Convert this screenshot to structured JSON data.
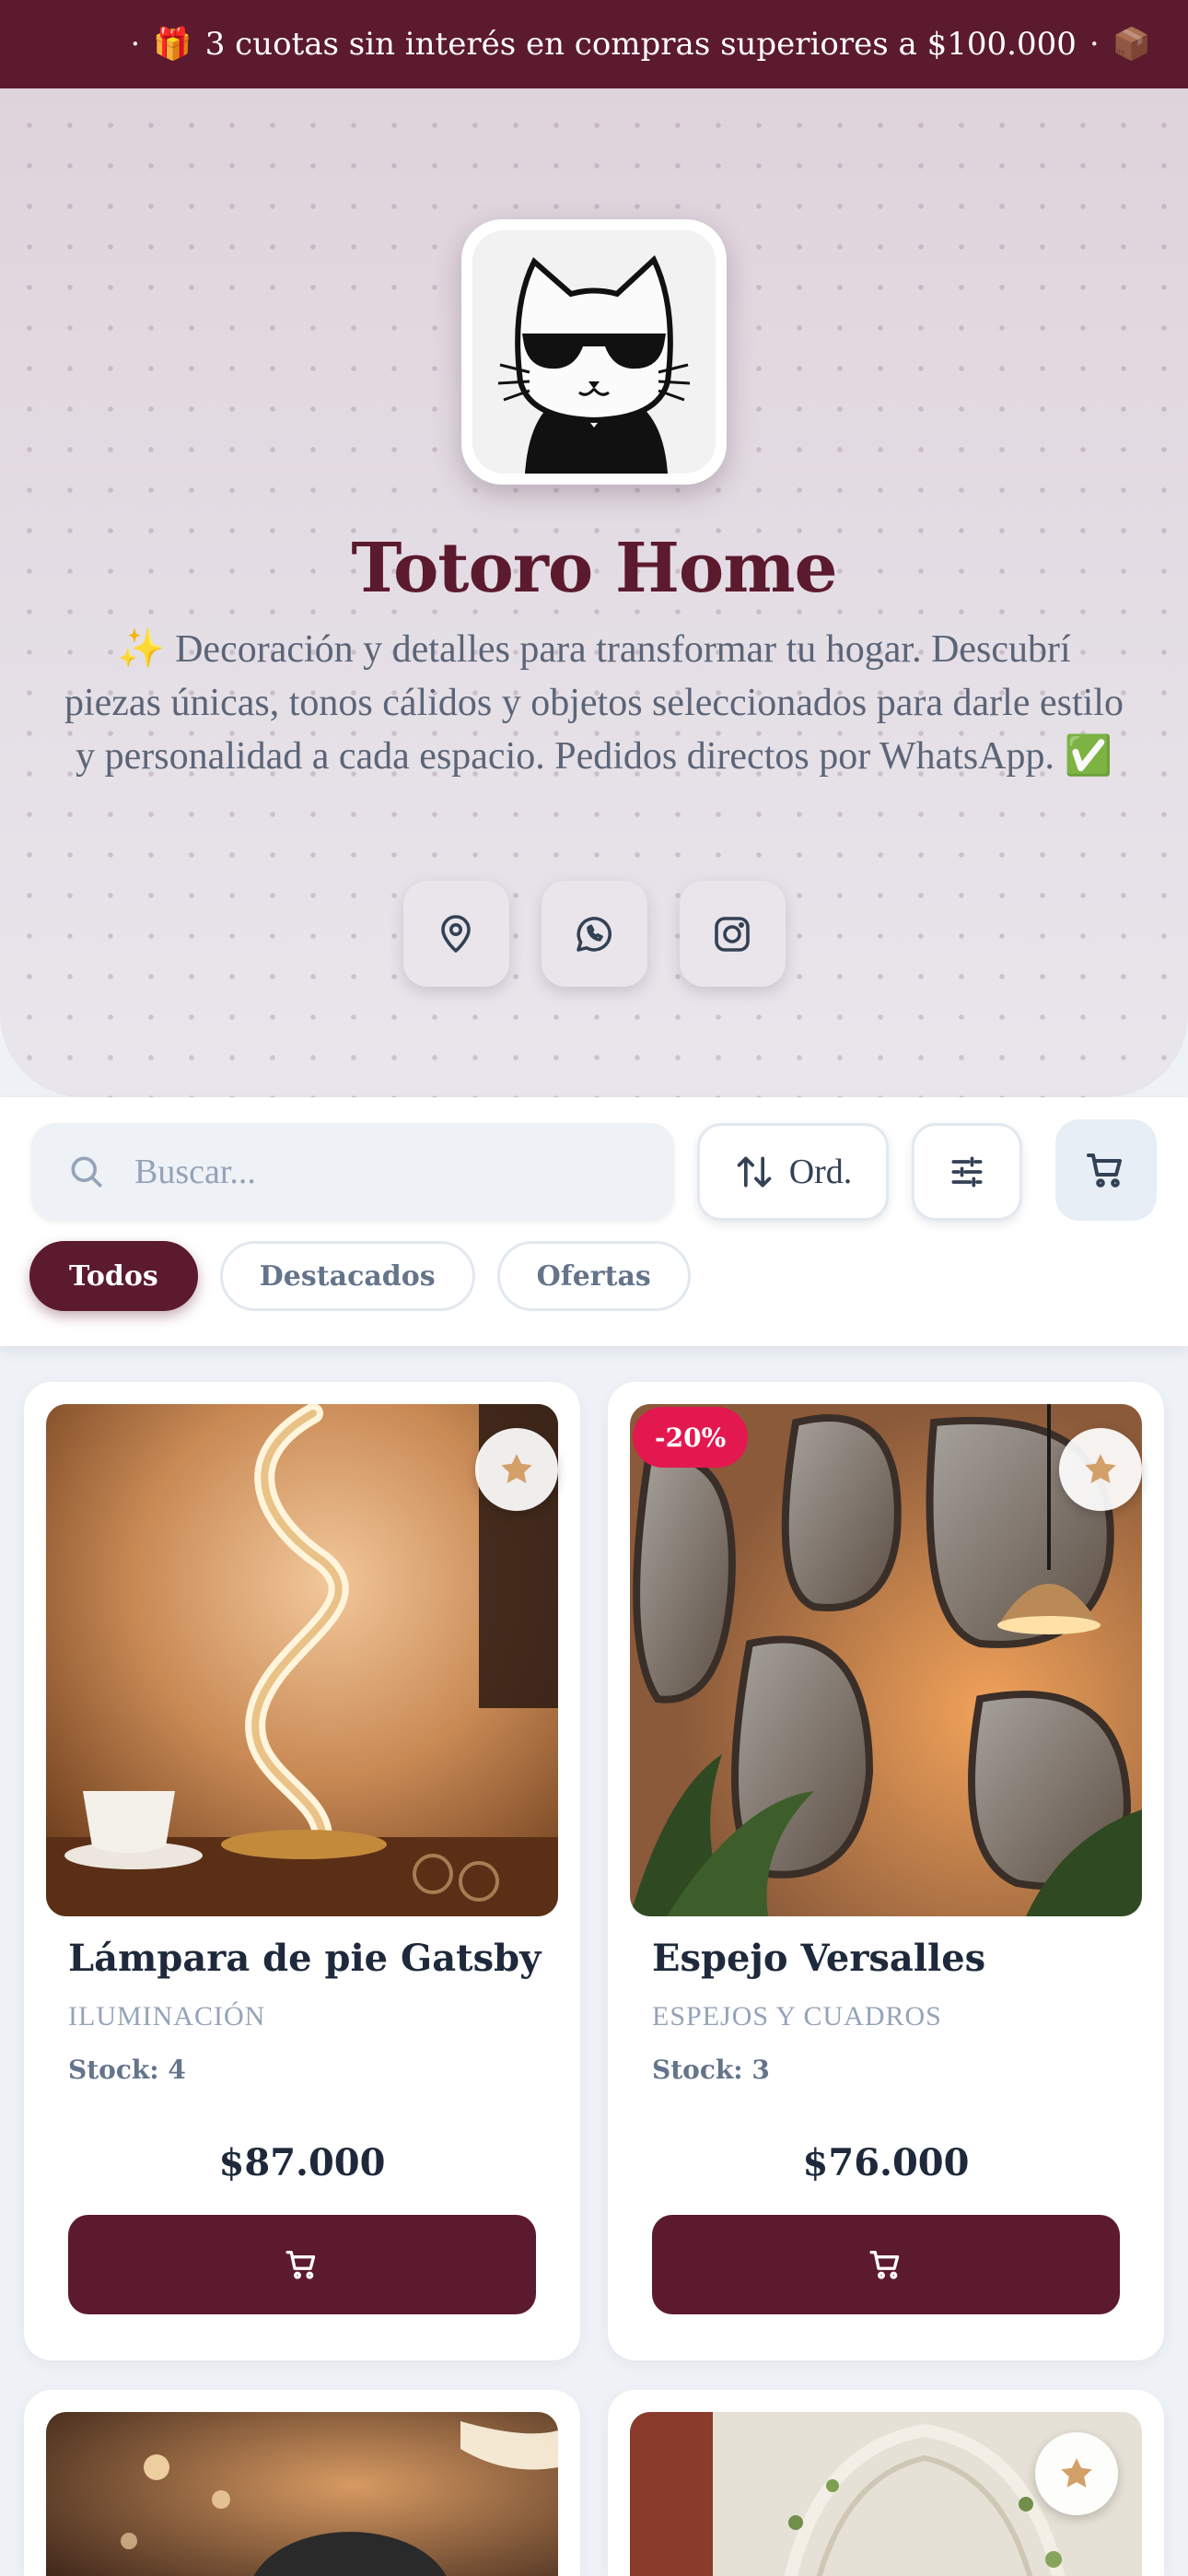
{
  "announcement": {
    "text": "3 cuotas sin interés en compras superiores a $100.000",
    "separator": "·",
    "leading_icon": "gift-icon",
    "trailing_icon": "package-icon"
  },
  "store": {
    "name": "Totoro Home",
    "description": "✨ Decoración y detalles para transformar tu hogar. Descubrí piezas únicas, tonos cálidos y objetos seleccionados para darle estilo y personalidad a cada espacio. Pedidos directos por WhatsApp. ✅",
    "logo": "cat-with-sunglasses-logo",
    "social": [
      {
        "name": "location",
        "icon": "map-pin-icon"
      },
      {
        "name": "whatsapp",
        "icon": "whatsapp-icon"
      },
      {
        "name": "instagram",
        "icon": "instagram-icon"
      }
    ]
  },
  "toolbar": {
    "search_placeholder": "Buscar...",
    "sort_label": "Ord.",
    "filter_icon": "sliders-icon",
    "cart_icon": "cart-icon"
  },
  "chips": [
    {
      "label": "Todos",
      "active": true
    },
    {
      "label": "Destacados",
      "active": false
    },
    {
      "label": "Ofertas",
      "active": false
    }
  ],
  "products": [
    {
      "name": "Lámpara de pie Gatsby",
      "category": "ILUMINACIÓN",
      "stock": "Stock: 4",
      "price": "$87.000",
      "badge": "",
      "image": "spiral-led-lamp"
    },
    {
      "name": "Espejo Versalles",
      "category": "ESPEJOS Y CUADROS",
      "stock": "Stock: 3",
      "price": "$76.000",
      "badge": "-20%",
      "image": "organic-mirrors-pendant-lamp"
    },
    {
      "name": "",
      "category": "",
      "stock": "",
      "price": "",
      "badge": "",
      "image": "lamp-partial"
    },
    {
      "name": "",
      "category": "",
      "stock": "",
      "price": "",
      "badge": "",
      "image": "hanging-chair-partial"
    }
  ],
  "colors": {
    "brand": "#5c1a2e",
    "badge": "#e3184f",
    "star": "#d4a06a",
    "background": "#eef2f7"
  }
}
